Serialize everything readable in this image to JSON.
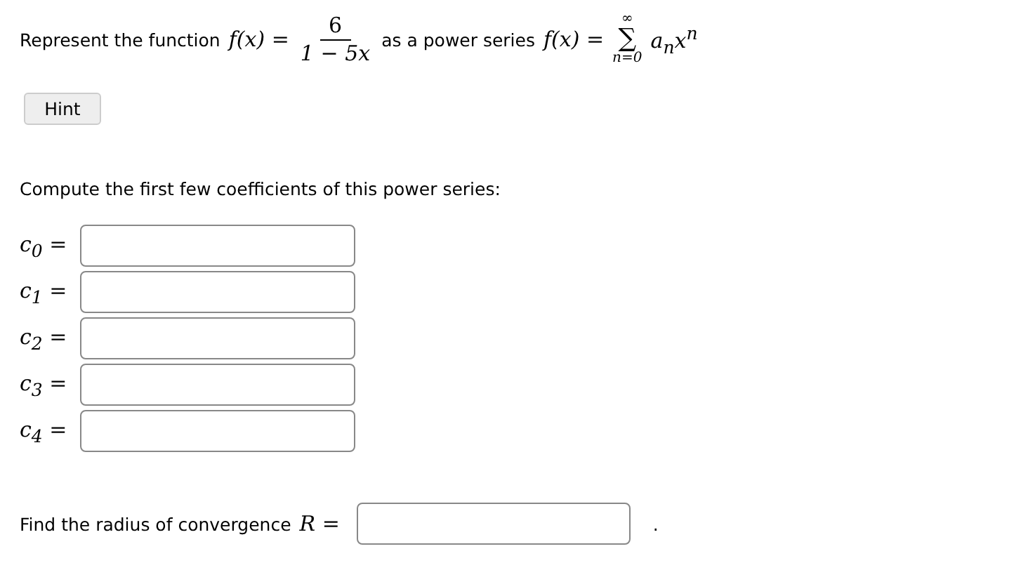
{
  "problem": {
    "intro": "Represent the function",
    "function_lhs": "f(x) =",
    "fraction": {
      "numerator": "6",
      "denominator": "1 − 5x"
    },
    "middle": "as a power series",
    "series_lhs": "f(x) =",
    "sum": {
      "upper": "∞",
      "symbol": "∑",
      "lower": "n=0"
    },
    "term": "a$_{n}$x$^{n}$"
  },
  "hint_button": "Hint",
  "prompt": "Compute the first few coefficients of this power series:",
  "coefficients": [
    {
      "label": "c$_{0}$ ="
    },
    {
      "label": "c$_{1}$ ="
    },
    {
      "label": "c$_{2}$ ="
    },
    {
      "label": "c$_{3}$ ="
    },
    {
      "label": "c$_{4}$ ="
    }
  ],
  "radius": {
    "text": "Find the radius of convergence",
    "symbol": "R =",
    "period": "."
  }
}
